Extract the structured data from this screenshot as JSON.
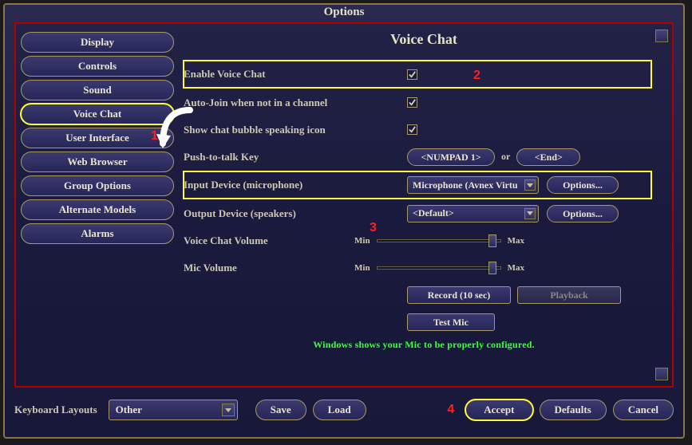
{
  "window": {
    "title": "Options"
  },
  "sidebar": {
    "items": [
      {
        "label": "Display"
      },
      {
        "label": "Controls"
      },
      {
        "label": "Sound"
      },
      {
        "label": "Voice Chat"
      },
      {
        "label": "User Interface"
      },
      {
        "label": "Web Browser"
      },
      {
        "label": "Group Options"
      },
      {
        "label": "Alternate Models"
      },
      {
        "label": "Alarms"
      }
    ],
    "selected_index": 3
  },
  "panel": {
    "title": "Voice Chat",
    "enable": {
      "label": "Enable Voice Chat",
      "checked": true
    },
    "autojoin": {
      "label": "Auto-Join when not in a channel",
      "checked": true
    },
    "bubble": {
      "label": "Show chat bubble speaking icon",
      "checked": true
    },
    "ptt": {
      "label": "Push-to-talk Key",
      "key1": "<NUMPAD 1>",
      "or": "or",
      "key2": "<End>"
    },
    "input": {
      "label": "Input Device (microphone)",
      "value": "Microphone (Avnex Virtu",
      "options_btn": "Options..."
    },
    "output": {
      "label": "Output Device (speakers)",
      "value": "<Default>",
      "options_btn": "Options..."
    },
    "vc_volume": {
      "label": "Voice Chat Volume",
      "min": "Min",
      "max": "Max",
      "percent": 88
    },
    "mic_volume": {
      "label": "Mic Volume",
      "min": "Min",
      "max": "Max",
      "percent": 88
    },
    "record_btn": "Record (10 sec)",
    "playback_btn": "Playback",
    "testmic_btn": "Test Mic",
    "status": "Windows shows your Mic to be properly configured."
  },
  "footer": {
    "kb_label": "Keyboard Layouts",
    "kb_value": "Other",
    "save": "Save",
    "load": "Load",
    "accept": "Accept",
    "defaults": "Defaults",
    "cancel": "Cancel"
  },
  "annotations": {
    "a1": "1",
    "a2": "2",
    "a3": "3",
    "a4": "4"
  }
}
